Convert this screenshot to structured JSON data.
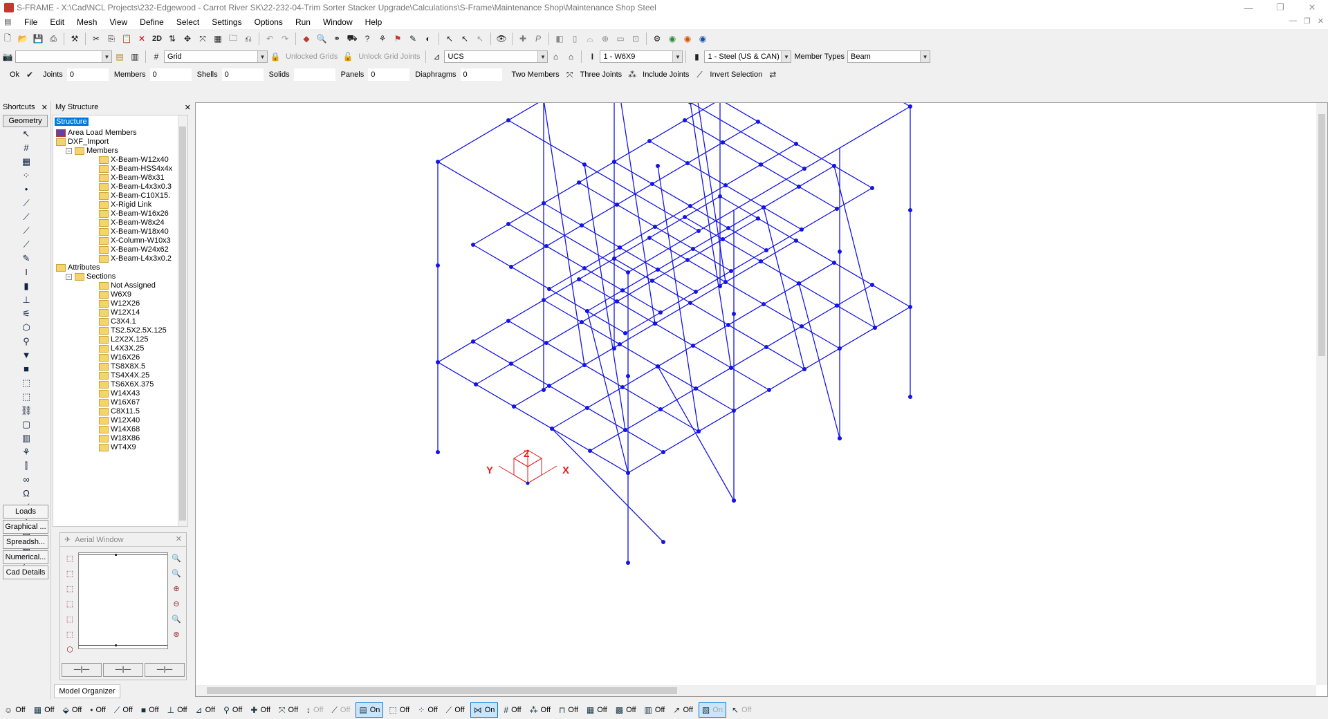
{
  "window": {
    "title": "S-FRAME - X:\\Cad\\NCL Projects\\232-Edgewood - Carrot River SK\\22-232-04-Trim Sorter Stacker Upgrade\\Calculations\\S-Frame\\Maintenance Shop\\Maintenance Shop Steel"
  },
  "menu": [
    "File",
    "Edit",
    "Mesh",
    "View",
    "Define",
    "Select",
    "Settings",
    "Options",
    "Run",
    "Window",
    "Help"
  ],
  "toolbar1": {
    "view_2d_label": "2D"
  },
  "toolbar2": {
    "grid_label": "Grid",
    "unlocked_grids": "Unlocked Grids",
    "unlock_grid_joints": "Unlock Grid Joints",
    "ucs_label": "UCS",
    "section_value": "1 - W6X9",
    "material_value": "1 - Steel (US & CAN)",
    "member_types_label": "Member Types",
    "member_types_value": "Beam"
  },
  "selection_bar": {
    "ok_label": "Ok",
    "joints_label": "Joints",
    "joints_value": "0",
    "members_label": "Members",
    "members_value": "0",
    "shells_label": "Shells",
    "shells_value": "0",
    "solids_label": "Solids",
    "solids_value": "",
    "panels_label": "Panels",
    "panels_value": "0",
    "diaphragms_label": "Diaphragms",
    "diaphragms_value": "0",
    "two_members": "Two Members",
    "three_joints": "Three Joints",
    "include_joints": "Include Joints",
    "invert_selection": "Invert Selection"
  },
  "shortcuts": {
    "title": "Shortcuts",
    "geometry_tab": "Geometry",
    "bottom_tabs": [
      "Loads",
      "Graphical ...",
      "Spreadsh...",
      "Numerical...",
      "Cad Details"
    ]
  },
  "my_structure": {
    "title": "My Structure",
    "root": "Structure",
    "nodes": [
      {
        "label": "Area Load Members",
        "indent": 0,
        "kind": "special"
      },
      {
        "label": "DXF_Import",
        "indent": 0,
        "kind": "folder"
      },
      {
        "label": "Members",
        "indent": 1,
        "kind": "folder",
        "expander": "−"
      },
      {
        "label": "X-Beam-W12x40",
        "indent": 2,
        "kind": "folder"
      },
      {
        "label": "X-Beam-HSS4x4x",
        "indent": 2,
        "kind": "folder"
      },
      {
        "label": "X-Beam-W8x31",
        "indent": 2,
        "kind": "folder"
      },
      {
        "label": "X-Beam-L4x3x0.3",
        "indent": 2,
        "kind": "folder"
      },
      {
        "label": "X-Beam-C10X15.",
        "indent": 2,
        "kind": "folder"
      },
      {
        "label": "X-Rigid Link",
        "indent": 2,
        "kind": "folder"
      },
      {
        "label": "X-Beam-W16x26",
        "indent": 2,
        "kind": "folder"
      },
      {
        "label": "X-Beam-W8x24",
        "indent": 2,
        "kind": "folder"
      },
      {
        "label": "X-Beam-W18x40",
        "indent": 2,
        "kind": "folder"
      },
      {
        "label": "X-Column-W10x3",
        "indent": 2,
        "kind": "folder"
      },
      {
        "label": "X-Beam-W24x62",
        "indent": 2,
        "kind": "folder"
      },
      {
        "label": "X-Beam-L4x3x0.2",
        "indent": 2,
        "kind": "folder"
      },
      {
        "label": "Attributes",
        "indent": 0,
        "kind": "folder"
      },
      {
        "label": "Sections",
        "indent": 1,
        "kind": "folder",
        "expander": "−"
      },
      {
        "label": "Not Assigned",
        "indent": 2,
        "kind": "folder"
      },
      {
        "label": "W6X9",
        "indent": 2,
        "kind": "folder"
      },
      {
        "label": "W12X26",
        "indent": 2,
        "kind": "folder"
      },
      {
        "label": "W12X14",
        "indent": 2,
        "kind": "folder"
      },
      {
        "label": "C3X4.1",
        "indent": 2,
        "kind": "folder"
      },
      {
        "label": "TS2.5X2.5X.125",
        "indent": 2,
        "kind": "folder"
      },
      {
        "label": "L2X2X.125",
        "indent": 2,
        "kind": "folder"
      },
      {
        "label": "L4X3X.25",
        "indent": 2,
        "kind": "folder"
      },
      {
        "label": "W16X26",
        "indent": 2,
        "kind": "folder"
      },
      {
        "label": "TS8X8X.5",
        "indent": 2,
        "kind": "folder"
      },
      {
        "label": "TS4X4X.25",
        "indent": 2,
        "kind": "folder"
      },
      {
        "label": "TS6X6X.375",
        "indent": 2,
        "kind": "folder"
      },
      {
        "label": "W14X43",
        "indent": 2,
        "kind": "folder"
      },
      {
        "label": "W16X67",
        "indent": 2,
        "kind": "folder"
      },
      {
        "label": "C8X11.5",
        "indent": 2,
        "kind": "folder"
      },
      {
        "label": "W12X40",
        "indent": 2,
        "kind": "folder"
      },
      {
        "label": "W14X68",
        "indent": 2,
        "kind": "folder"
      },
      {
        "label": "W18X86",
        "indent": 2,
        "kind": "folder"
      },
      {
        "label": "WT4X9",
        "indent": 2,
        "kind": "folder"
      }
    ]
  },
  "aerial": {
    "title": "Aerial Window"
  },
  "model_organizer_tab": "Model Organizer",
  "axes": {
    "x": "X",
    "y": "Y",
    "z": "Z",
    "color": "#e41b1b"
  },
  "colors": {
    "model": "#1414e6",
    "axis": "#e41b1b",
    "selection": "#0078d7"
  },
  "status_bar": [
    {
      "icon": "smiley-icon",
      "glyph": "☺",
      "state": "Off"
    },
    {
      "icon": "member-icon",
      "glyph": "▦",
      "state": "Off"
    },
    {
      "icon": "loads-icon",
      "glyph": "⬙",
      "state": "Off"
    },
    {
      "icon": "joint-icon",
      "glyph": "•",
      "state": "Off"
    },
    {
      "icon": "line-icon",
      "glyph": "⟋",
      "state": "Off"
    },
    {
      "icon": "box-icon",
      "glyph": "■",
      "state": "Off"
    },
    {
      "icon": "support-icon",
      "glyph": "⊥",
      "state": "Off"
    },
    {
      "icon": "axis-icon",
      "glyph": "⊿",
      "state": "Off"
    },
    {
      "icon": "release-icon",
      "glyph": "⚲",
      "state": "Off"
    },
    {
      "icon": "cross-icon",
      "glyph": "✚",
      "state": "Off"
    },
    {
      "icon": "orient-icon",
      "glyph": "⤧",
      "state": "Off"
    },
    {
      "icon": "offset-icon",
      "glyph": "↕",
      "state": "Off",
      "disabled": true
    },
    {
      "icon": "spring-icon",
      "glyph": "⟋",
      "state": "Off",
      "disabled": true
    },
    {
      "icon": "color-icon",
      "glyph": "▤",
      "state": "On",
      "active": true
    },
    {
      "icon": "extrude-icon",
      "glyph": "⬚",
      "state": "Off"
    },
    {
      "icon": "points-icon",
      "glyph": "⁘",
      "state": "Off"
    },
    {
      "icon": "pin-icon",
      "glyph": "⟋",
      "state": "Off"
    },
    {
      "icon": "perspective-icon",
      "glyph": "⋈",
      "state": "On",
      "active": true
    },
    {
      "icon": "grid-icon",
      "glyph": "#",
      "state": "Off"
    },
    {
      "icon": "nodes-icon",
      "glyph": "⁂",
      "state": "Off"
    },
    {
      "icon": "rigid-icon",
      "glyph": "⊓",
      "state": "Off"
    },
    {
      "icon": "table-icon",
      "glyph": "▦",
      "state": "Off"
    },
    {
      "icon": "matrix-icon",
      "glyph": "▩",
      "state": "Off"
    },
    {
      "icon": "table2-icon",
      "glyph": "▥",
      "state": "Off"
    },
    {
      "icon": "arrow-icon",
      "glyph": "↗",
      "state": "Off"
    },
    {
      "icon": "mesh-icon",
      "glyph": "▧",
      "state": "On",
      "disabled": true,
      "active": true
    },
    {
      "icon": "cursor-icon",
      "glyph": "↖",
      "state": "Off",
      "disabled": true
    }
  ]
}
